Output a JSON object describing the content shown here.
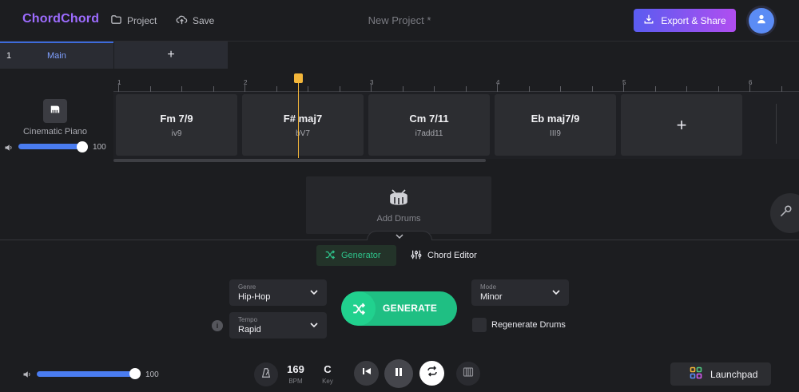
{
  "app": {
    "logo": "ChordChord",
    "project_label": "Project",
    "save_label": "Save",
    "title": "New Project *",
    "export_label": "Export & Share"
  },
  "tabs": [
    {
      "number": "1",
      "label": "Main"
    },
    {
      "label": "+"
    }
  ],
  "ruler": {
    "bars": [
      "1",
      "2",
      "3",
      "4",
      "5",
      "6"
    ]
  },
  "track": {
    "instrument": "Cinematic Piano",
    "volume": 100,
    "volume_label": "100",
    "chords": [
      {
        "name": "Fm 7/9",
        "numeral": "iv9"
      },
      {
        "name": "F# maj7",
        "numeral": "bV7"
      },
      {
        "name": "Cm 7/11",
        "numeral": "i7add11"
      },
      {
        "name": "Eb maj7/9",
        "numeral": "III9"
      }
    ],
    "add_chord": "+"
  },
  "drums": {
    "label": "Add Drums"
  },
  "panel": {
    "tabs": {
      "generator": "Generator",
      "chord_editor": "Chord Editor"
    },
    "genre": {
      "label": "Genre",
      "value": "Hip-Hop"
    },
    "tempo": {
      "label": "Tempo",
      "value": "Rapid"
    },
    "mode": {
      "label": "Mode",
      "value": "Minor"
    },
    "info": "i",
    "generate_label": "GENERATE",
    "regenerate_drums_label": "Regenerate Drums",
    "regenerate_drums_checked": false
  },
  "transport": {
    "master_volume": 100,
    "master_volume_label": "100",
    "bpm": "169",
    "bpm_label": "BPM",
    "key": "C",
    "key_label": "Key",
    "launchpad_label": "Launchpad"
  },
  "colors": {
    "accent": "#9d6cff",
    "generate": "#1fbf83",
    "playhead": "#f3b63a",
    "slider": "#4a7cf0"
  }
}
